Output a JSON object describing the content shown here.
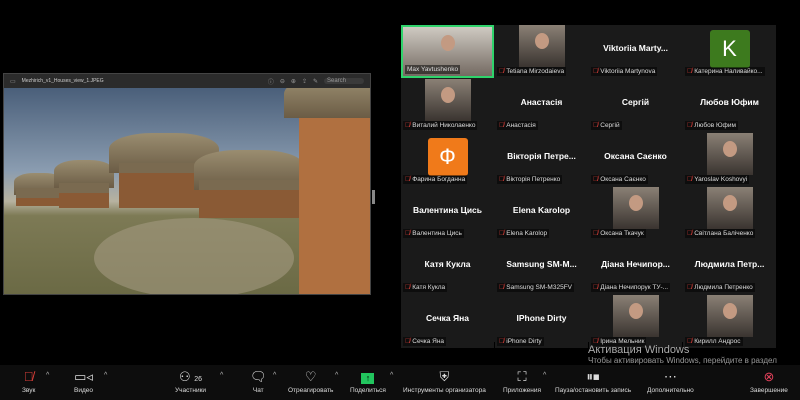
{
  "share": {
    "filename": "Mezhirich_v1_Houses_view_1.JPEG",
    "search_placeholder": "Search"
  },
  "tiles": [
    {
      "label": "Max Yavtushenko",
      "type": "wide",
      "active": true,
      "muted": false
    },
    {
      "label": "Tetiana Mirzodaieva",
      "type": "video",
      "muted": true
    },
    {
      "big": "Viktoriia  Marty...",
      "label": "Viktoriia Martynova",
      "type": "name",
      "muted": true
    },
    {
      "label": "Катерина Наливайко...",
      "type": "avatar",
      "letter": "K",
      "color": "#3d7a1e",
      "muted": true
    },
    {
      "label": "Виталий Николаенко",
      "type": "video",
      "muted": true
    },
    {
      "big": "Анастасія",
      "label": "Анастасія",
      "type": "name",
      "muted": true
    },
    {
      "big": "Сергій",
      "label": "Сергій",
      "type": "name",
      "muted": true
    },
    {
      "big": "Любов Юфим",
      "label": "Любов Юфим",
      "type": "name",
      "muted": true
    },
    {
      "label": "Фарина Богданна",
      "type": "avatar",
      "letter": "Ф",
      "color": "#f07a1a",
      "muted": true
    },
    {
      "big": "Вікторія  Петре...",
      "label": "Вікторія Петренко",
      "type": "name",
      "muted": true
    },
    {
      "big": "Оксана Саєнко",
      "label": "Оксана Саєнко",
      "type": "name",
      "muted": true
    },
    {
      "label": "Yaroslav Koshovyi",
      "type": "video",
      "muted": true
    },
    {
      "big": "Валентина Цись",
      "label": "Валентина Цись",
      "type": "name",
      "muted": true
    },
    {
      "big": "Elena Karolop",
      "label": "Elena Karolop",
      "type": "name",
      "muted": true
    },
    {
      "label": "Оксана Ткачук",
      "type": "video",
      "muted": true
    },
    {
      "label": "Світлана Балiченко",
      "type": "video",
      "muted": true
    },
    {
      "big": "Катя Кукла",
      "label": "Катя Кукла",
      "type": "name",
      "muted": true
    },
    {
      "big": "Samsung  SM-M...",
      "label": "Samsung SM-M325FV",
      "type": "name",
      "muted": true
    },
    {
      "big": "Діана  Нечипор...",
      "label": "Діана Нечипорук ТУ-...",
      "type": "name",
      "muted": true
    },
    {
      "big": "Людмила  Петр...",
      "label": "Людмила Петренко",
      "type": "name",
      "muted": true
    },
    {
      "big": "Сечка Яна",
      "label": "Сечка Яна",
      "type": "name",
      "muted": true
    },
    {
      "big": "IPhone Dirty",
      "label": "iPhone Dirty",
      "type": "name",
      "muted": true
    },
    {
      "label": "Ірина Мельник",
      "type": "video",
      "muted": true
    },
    {
      "label": "Кирилл Андрос",
      "type": "video",
      "muted": true
    }
  ],
  "watermark": {
    "title": "Активация Windows",
    "subtitle": "Чтобы активировать Windows, перейдите в раздел \"Параметры\"."
  },
  "toolbar": {
    "audio": "Звук",
    "video": "Видео",
    "participants": "Участники",
    "participants_count": "26",
    "chat": "Чат",
    "react": "Отреагировать",
    "share": "Поделиться",
    "host_tools": "Инструменты организатора",
    "apps": "Приложения",
    "record": "Пауза/остановить запись",
    "more": "Дополнительно",
    "end": "Завершение"
  }
}
